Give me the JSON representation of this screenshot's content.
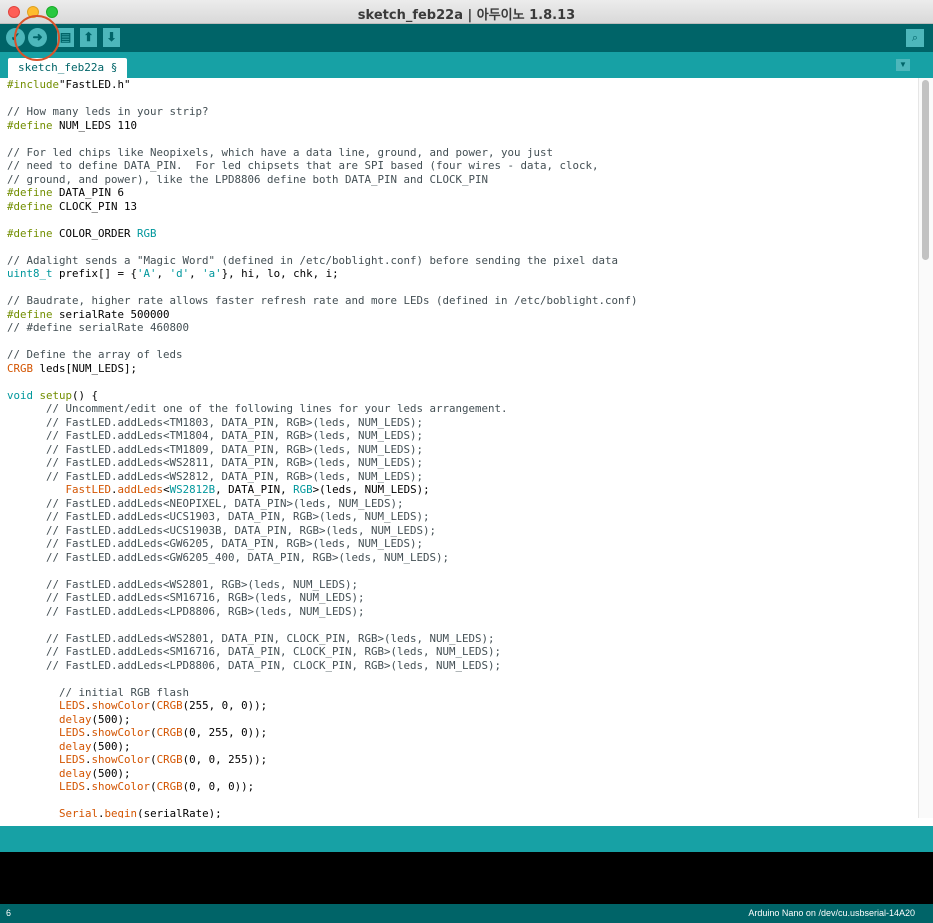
{
  "window": {
    "title": "sketch_feb22a | 아두이노 1.8.13"
  },
  "toolbar": {
    "verify_icon": "check-icon",
    "upload_icon": "arrow-right-icon",
    "new_icon": "new-file-icon",
    "open_icon": "arrow-up-icon",
    "save_icon": "arrow-down-icon",
    "serial_monitor_icon": "magnifier-icon"
  },
  "tabs": [
    {
      "label": "sketch_feb22a §"
    }
  ],
  "editor": {
    "lines": [
      [
        [
          "k",
          "#include"
        ],
        [
          "",
          "\"FastLED.h\""
        ]
      ],
      [],
      [
        [
          "c",
          "// How many leds in your strip?"
        ]
      ],
      [
        [
          "k",
          "#define"
        ],
        [
          "",
          " NUM_LEDS 110"
        ]
      ],
      [],
      [
        [
          "c",
          "// For led chips like Neopixels, which have a data line, ground, and power, you just"
        ]
      ],
      [
        [
          "c",
          "// need to define DATA_PIN.  For led chipsets that are SPI based (four wires - data, clock,"
        ]
      ],
      [
        [
          "c",
          "// ground, and power), like the LPD8806 define both DATA_PIN and CLOCK_PIN"
        ]
      ],
      [
        [
          "k",
          "#define"
        ],
        [
          "",
          " DATA_PIN 6"
        ]
      ],
      [
        [
          "k",
          "#define"
        ],
        [
          "",
          " CLOCK_PIN 13"
        ]
      ],
      [],
      [
        [
          "k",
          "#define"
        ],
        [
          "",
          " COLOR_ORDER "
        ],
        [
          "t",
          "RGB"
        ]
      ],
      [],
      [
        [
          "c",
          "// Adalight sends a \"Magic Word\" (defined in /etc/boblight.conf) before sending the pixel data"
        ]
      ],
      [
        [
          "t",
          "uint8_t"
        ],
        [
          "",
          " prefix[] = {"
        ],
        [
          "t",
          "'A'"
        ],
        [
          "",
          ", "
        ],
        [
          "t",
          "'d'"
        ],
        [
          "",
          ", "
        ],
        [
          "t",
          "'a'"
        ],
        [
          "",
          "}, hi, lo, chk, i;"
        ]
      ],
      [],
      [
        [
          "c",
          "// Baudrate, higher rate allows faster refresh rate and more LEDs (defined in /etc/boblight.conf)"
        ]
      ],
      [
        [
          "k",
          "#define"
        ],
        [
          "",
          " serialRate 500000"
        ]
      ],
      [
        [
          "c",
          "// #define serialRate 460800"
        ]
      ],
      [],
      [
        [
          "c",
          "// Define the array of leds"
        ]
      ],
      [
        [
          "f",
          "CRGB"
        ],
        [
          "",
          " leds[NUM_LEDS];"
        ]
      ],
      [],
      [
        [
          "t",
          "void"
        ],
        [
          "",
          " "
        ],
        [
          "k",
          "setup"
        ],
        [
          "",
          "() {"
        ]
      ],
      [
        [
          "",
          "      "
        ],
        [
          "c",
          "// Uncomment/edit one of the following lines for your leds arrangement."
        ]
      ],
      [
        [
          "",
          "      "
        ],
        [
          "c",
          "// FastLED.addLeds<TM1803, DATA_PIN, RGB>(leds, NUM_LEDS);"
        ]
      ],
      [
        [
          "",
          "      "
        ],
        [
          "c",
          "// FastLED.addLeds<TM1804, DATA_PIN, RGB>(leds, NUM_LEDS);"
        ]
      ],
      [
        [
          "",
          "      "
        ],
        [
          "c",
          "// FastLED.addLeds<TM1809, DATA_PIN, RGB>(leds, NUM_LEDS);"
        ]
      ],
      [
        [
          "",
          "      "
        ],
        [
          "c",
          "// FastLED.addLeds<WS2811, DATA_PIN, RGB>(leds, NUM_LEDS);"
        ]
      ],
      [
        [
          "",
          "      "
        ],
        [
          "c",
          "// FastLED.addLeds<WS2812, DATA_PIN, RGB>(leds, NUM_LEDS);"
        ]
      ],
      [
        [
          "",
          "         "
        ],
        [
          "f",
          "FastLED"
        ],
        [
          "",
          "."
        ],
        [
          "f",
          "addLeds"
        ],
        [
          "",
          "<"
        ],
        [
          "t",
          "WS2812B"
        ],
        [
          "",
          ", DATA_PIN, "
        ],
        [
          "t",
          "RGB"
        ],
        [
          "",
          ">(leds, NUM_LEDS);"
        ]
      ],
      [
        [
          "",
          "      "
        ],
        [
          "c",
          "// FastLED.addLeds<NEOPIXEL, DATA_PIN>(leds, NUM_LEDS);"
        ]
      ],
      [
        [
          "",
          "      "
        ],
        [
          "c",
          "// FastLED.addLeds<UCS1903, DATA_PIN, RGB>(leds, NUM_LEDS);"
        ]
      ],
      [
        [
          "",
          "      "
        ],
        [
          "c",
          "// FastLED.addLeds<UCS1903B, DATA_PIN, RGB>(leds, NUM_LEDS);"
        ]
      ],
      [
        [
          "",
          "      "
        ],
        [
          "c",
          "// FastLED.addLeds<GW6205, DATA_PIN, RGB>(leds, NUM_LEDS);"
        ]
      ],
      [
        [
          "",
          "      "
        ],
        [
          "c",
          "// FastLED.addLeds<GW6205_400, DATA_PIN, RGB>(leds, NUM_LEDS);"
        ]
      ],
      [],
      [
        [
          "",
          "      "
        ],
        [
          "c",
          "// FastLED.addLeds<WS2801, RGB>(leds, NUM_LEDS);"
        ]
      ],
      [
        [
          "",
          "      "
        ],
        [
          "c",
          "// FastLED.addLeds<SM16716, RGB>(leds, NUM_LEDS);"
        ]
      ],
      [
        [
          "",
          "      "
        ],
        [
          "c",
          "// FastLED.addLeds<LPD8806, RGB>(leds, NUM_LEDS);"
        ]
      ],
      [],
      [
        [
          "",
          "      "
        ],
        [
          "c",
          "// FastLED.addLeds<WS2801, DATA_PIN, CLOCK_PIN, RGB>(leds, NUM_LEDS);"
        ]
      ],
      [
        [
          "",
          "      "
        ],
        [
          "c",
          "// FastLED.addLeds<SM16716, DATA_PIN, CLOCK_PIN, RGB>(leds, NUM_LEDS);"
        ]
      ],
      [
        [
          "",
          "      "
        ],
        [
          "c",
          "// FastLED.addLeds<LPD8806, DATA_PIN, CLOCK_PIN, RGB>(leds, NUM_LEDS);"
        ]
      ],
      [],
      [
        [
          "",
          "        "
        ],
        [
          "c",
          "// initial RGB flash"
        ]
      ],
      [
        [
          "",
          "        "
        ],
        [
          "f",
          "LEDS"
        ],
        [
          "",
          "."
        ],
        [
          "f",
          "showColor"
        ],
        [
          "",
          "("
        ],
        [
          "f",
          "CRGB"
        ],
        [
          "",
          "(255, 0, 0));"
        ]
      ],
      [
        [
          "",
          "        "
        ],
        [
          "f",
          "delay"
        ],
        [
          "",
          "(500);"
        ]
      ],
      [
        [
          "",
          "        "
        ],
        [
          "f",
          "LEDS"
        ],
        [
          "",
          "."
        ],
        [
          "f",
          "showColor"
        ],
        [
          "",
          "("
        ],
        [
          "f",
          "CRGB"
        ],
        [
          "",
          "(0, 255, 0));"
        ]
      ],
      [
        [
          "",
          "        "
        ],
        [
          "f",
          "delay"
        ],
        [
          "",
          "(500);"
        ]
      ],
      [
        [
          "",
          "        "
        ],
        [
          "f",
          "LEDS"
        ],
        [
          "",
          "."
        ],
        [
          "f",
          "showColor"
        ],
        [
          "",
          "("
        ],
        [
          "f",
          "CRGB"
        ],
        [
          "",
          "(0, 0, 255));"
        ]
      ],
      [
        [
          "",
          "        "
        ],
        [
          "f",
          "delay"
        ],
        [
          "",
          "(500);"
        ]
      ],
      [
        [
          "",
          "        "
        ],
        [
          "f",
          "LEDS"
        ],
        [
          "",
          "."
        ],
        [
          "f",
          "showColor"
        ],
        [
          "",
          "("
        ],
        [
          "f",
          "CRGB"
        ],
        [
          "",
          "(0, 0, 0));"
        ]
      ],
      [],
      [
        [
          "",
          "        "
        ],
        [
          "f",
          "Serial"
        ],
        [
          "",
          "."
        ],
        [
          "f",
          "begin"
        ],
        [
          "",
          "(serialRate);"
        ]
      ]
    ]
  },
  "status": {
    "line_number": "6",
    "board": "Arduino Nano on /dev/cu.usbserial-14A20"
  },
  "colors": {
    "toolbar": "#006468",
    "tab_bar": "#17a1a5",
    "button": "#4db7bb",
    "highlight_circle": "#d9532a",
    "comment": "#434f54",
    "keyword": "#728e00",
    "type": "#00979c",
    "function": "#d35400"
  }
}
